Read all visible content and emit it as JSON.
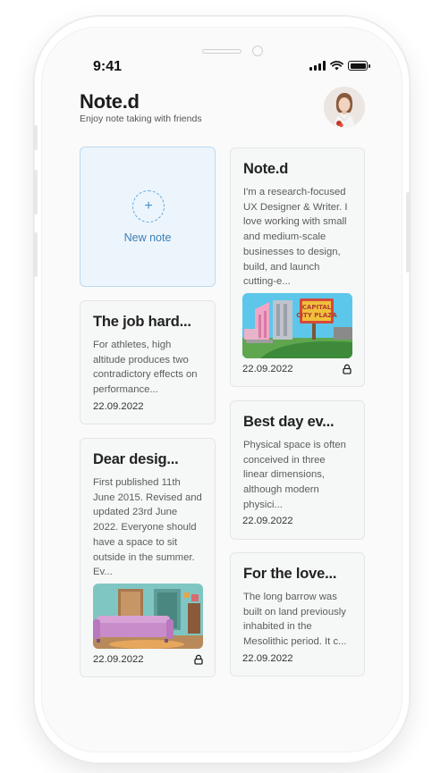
{
  "status_bar": {
    "time": "9:41"
  },
  "header": {
    "title": "Note.d",
    "subtitle": "Enjoy note taking with friends",
    "avatar_icon": "user-avatar-photo"
  },
  "new_note": {
    "label": "New note",
    "icon": "plus-icon"
  },
  "notes": [
    {
      "title": "Note.d",
      "body": "I'm a research-focused UX Designer & Writer. I love working with small and medium-scale businesses to design, build, and launch cutting-e...",
      "image": "city-plaza-illustration",
      "date": "22.09.2022",
      "locked": true
    },
    {
      "title": "The job hard...",
      "body": "For athletes, high altitude produces two contradictory effects on performance...",
      "date": "22.09.2022",
      "locked": false
    },
    {
      "title": "Best day ev...",
      "body": "Physical space is often conceived in three linear dimensions, although modern physici...",
      "date": "22.09.2022",
      "locked": false
    },
    {
      "title": "Dear desig...",
      "body": "First published 11th June 2015. Revised and updated 23rd June 2022. Everyone should have a space to sit outside in the summer. Ev...",
      "image": "living-room-illustration",
      "date": "22.09.2022",
      "locked": true
    },
    {
      "title": "For the love...",
      "body": "The long barrow was built on land previously inhabited in the Mesolithic period. It c...",
      "date": "22.09.2022",
      "locked": false
    }
  ],
  "colors": {
    "accent": "#3f93cf",
    "new_note_bg": "#edf5fc",
    "card_bg": "#f6f7f7"
  }
}
